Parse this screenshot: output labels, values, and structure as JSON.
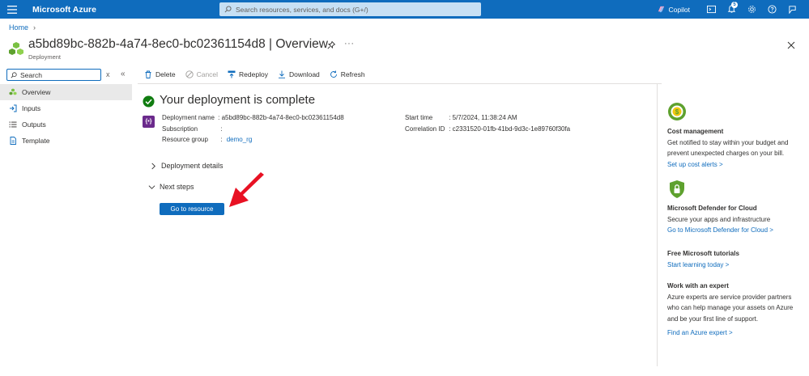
{
  "topbar": {
    "brand": "Microsoft Azure",
    "search_placeholder": "Search resources, services, and docs (G+/)",
    "copilot_label": "Copilot",
    "notification_count": "5"
  },
  "breadcrumb": {
    "home": "Home"
  },
  "header": {
    "title": "a5bd89bc-882b-4a74-8ec0-bc02361154d8 | Overview",
    "subtitle": "Deployment",
    "more": "···"
  },
  "nav": {
    "search_value": "Search",
    "clear": "x",
    "collapse": "«",
    "items": [
      {
        "label": "Overview"
      },
      {
        "label": "Inputs"
      },
      {
        "label": "Outputs"
      },
      {
        "label": "Template"
      }
    ]
  },
  "toolbar": {
    "delete": "Delete",
    "cancel": "Cancel",
    "redeploy": "Redeploy",
    "download": "Download",
    "refresh": "Refresh"
  },
  "main": {
    "status_title": "Your deployment is complete",
    "icon_text": "{•}",
    "deployment_name_label": "Deployment name",
    "deployment_name_value": ": a5bd89bc-882b-4a74-8ec0-bc02361154d8",
    "subscription_label": "Subscription",
    "subscription_value": ":",
    "resource_group_label": "Resource group",
    "resource_group_sep": ":",
    "resource_group_value": "demo_rg",
    "start_time_label": "Start time",
    "start_time_value": ": 5/7/2024, 11:38:24 AM",
    "correlation_label": "Correlation ID",
    "correlation_value": ": c2331520-01fb-41bd-9d3c-1e89760f30fa",
    "deployment_details": "Deployment details",
    "next_steps": "Next steps",
    "go_to_resource": "Go to resource"
  },
  "right_panel": {
    "cost_title": "Cost management",
    "cost_desc": "Get notified to stay within your budget and prevent unexpected charges on your bill.",
    "cost_link": "Set up cost alerts >",
    "defender_title": "Microsoft Defender for Cloud",
    "defender_desc": "Secure your apps and infrastructure",
    "defender_link": "Go to Microsoft Defender for Cloud >",
    "tutorials_title": "Free Microsoft tutorials",
    "tutorials_link": "Start learning today >",
    "expert_title": "Work with an expert",
    "expert_desc": "Azure experts are service provider partners who can help manage your assets on Azure and be your first line of support.",
    "expert_link": "Find an Azure expert >"
  },
  "colors": {
    "azure_blue": "#0f6cbd",
    "success_green": "#107c10",
    "arrow_red": "#e81123"
  }
}
